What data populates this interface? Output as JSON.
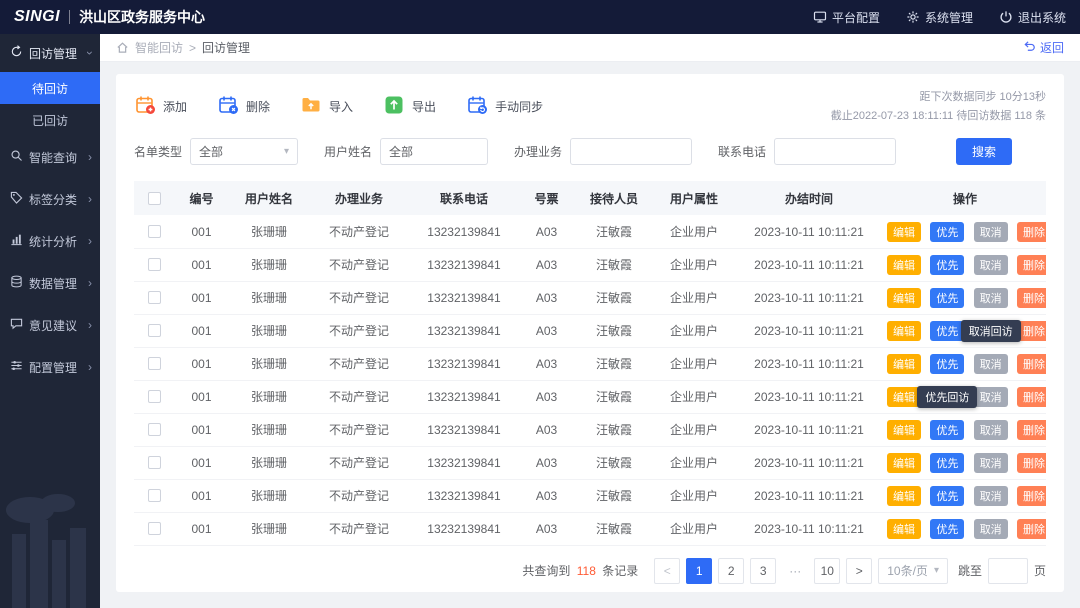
{
  "topbar": {
    "logo": "SINGI",
    "title": "洪山区政务服务中心",
    "menu": [
      {
        "label": "平台配置"
      },
      {
        "label": "系统管理"
      },
      {
        "label": "退出系统"
      }
    ]
  },
  "sidebar": {
    "group": {
      "label": "回访管理"
    },
    "sub_items": [
      {
        "label": "待回访"
      },
      {
        "label": "已回访"
      }
    ],
    "items": [
      {
        "label": "智能查询"
      },
      {
        "label": "标签分类"
      },
      {
        "label": "统计分析"
      },
      {
        "label": "数据管理"
      },
      {
        "label": "意见建议"
      },
      {
        "label": "配置管理"
      }
    ]
  },
  "breadcrumb": {
    "parent": "智能回访",
    "separator": ">",
    "current": "回访管理",
    "back": "返回"
  },
  "toolbar": {
    "add": "添加",
    "delete": "删除",
    "import": "导入",
    "export": "导出",
    "sync": "手动同步",
    "next_sync": "距下次数据同步 10分13秒",
    "cutoff": "截止2022-07-23 18:11:11  待回访数据 118 条"
  },
  "filters": {
    "list_type_label": "名单类型",
    "list_type_value": "全部",
    "user_name_label": "用户姓名",
    "user_name_value": "全部",
    "business_label": "办理业务",
    "business_value": "",
    "phone_label": "联系电话",
    "phone_value": "",
    "search": "搜索"
  },
  "table": {
    "headers": [
      "编号",
      "用户姓名",
      "办理业务",
      "联系电话",
      "号票",
      "接待人员",
      "用户属性",
      "办结时间",
      "操作"
    ],
    "action_labels": {
      "edit": "编辑",
      "priority": "优先",
      "cancel": "取消",
      "delete": "删除"
    },
    "rows": [
      {
        "no": "001",
        "name": "张珊珊",
        "business": "不动产登记",
        "phone": "13232139841",
        "ticket": "A03",
        "receptionist": "汪敏霞",
        "attribute": "企业用户",
        "time": "2023-10-11 10:11:21"
      },
      {
        "no": "001",
        "name": "张珊珊",
        "business": "不动产登记",
        "phone": "13232139841",
        "ticket": "A03",
        "receptionist": "汪敏霞",
        "attribute": "企业用户",
        "time": "2023-10-11 10:11:21"
      },
      {
        "no": "001",
        "name": "张珊珊",
        "business": "不动产登记",
        "phone": "13232139841",
        "ticket": "A03",
        "receptionist": "汪敏霞",
        "attribute": "企业用户",
        "time": "2023-10-11 10:11:21"
      },
      {
        "no": "001",
        "name": "张珊珊",
        "business": "不动产登记",
        "phone": "13232139841",
        "ticket": "A03",
        "receptionist": "汪敏霞",
        "attribute": "企业用户",
        "time": "2023-10-11 10:11:21",
        "tooltip": {
          "target": "cancel",
          "text": "取消回访"
        }
      },
      {
        "no": "001",
        "name": "张珊珊",
        "business": "不动产登记",
        "phone": "13232139841",
        "ticket": "A03",
        "receptionist": "汪敏霞",
        "attribute": "企业用户",
        "time": "2023-10-11 10:11:21"
      },
      {
        "no": "001",
        "name": "张珊珊",
        "business": "不动产登记",
        "phone": "13232139841",
        "ticket": "A03",
        "receptionist": "汪敏霞",
        "attribute": "企业用户",
        "time": "2023-10-11 10:11:21",
        "tooltip": {
          "target": "priority",
          "text": "优先回访"
        }
      },
      {
        "no": "001",
        "name": "张珊珊",
        "business": "不动产登记",
        "phone": "13232139841",
        "ticket": "A03",
        "receptionist": "汪敏霞",
        "attribute": "企业用户",
        "time": "2023-10-11 10:11:21"
      },
      {
        "no": "001",
        "name": "张珊珊",
        "business": "不动产登记",
        "phone": "13232139841",
        "ticket": "A03",
        "receptionist": "汪敏霞",
        "attribute": "企业用户",
        "time": "2023-10-11 10:11:21"
      },
      {
        "no": "001",
        "name": "张珊珊",
        "business": "不动产登记",
        "phone": "13232139841",
        "ticket": "A03",
        "receptionist": "汪敏霞",
        "attribute": "企业用户",
        "time": "2023-10-11 10:11:21"
      },
      {
        "no": "001",
        "name": "张珊珊",
        "business": "不动产登记",
        "phone": "13232139841",
        "ticket": "A03",
        "receptionist": "汪敏霞",
        "attribute": "企业用户",
        "time": "2023-10-11 10:11:21"
      }
    ]
  },
  "pagination": {
    "summary_prefix": "共查询到",
    "summary_count": "118",
    "summary_suffix": "条记录",
    "prev": "<",
    "next": ">",
    "pages": [
      "1",
      "2",
      "3",
      "···",
      "10"
    ],
    "active_page": "1",
    "ellipsis": "···",
    "page_size": "10条/页",
    "jump_label": "跳至",
    "jump_unit": "页"
  },
  "colors": {
    "accent_blue": "#2E6BF6",
    "edit_amber": "#FFAF00",
    "cancel_gray": "#A4AAB6",
    "delete_coral": "#FF8055",
    "count_red": "#FF5B35",
    "topbar_navy": "#141B38",
    "sidebar_navy": "#1F2637"
  }
}
